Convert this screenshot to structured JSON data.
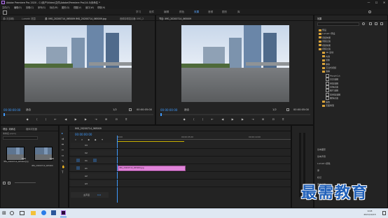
{
  "window": {
    "title": "Adobe Premiere Pro 2020 - C:\\用户\\Video\\文件\\Adobe\\Premiere Pro\\14.0\\未命名 *",
    "minimize": "—",
    "maximize": "☐",
    "close": "✕"
  },
  "menubar": [
    "文件(F)",
    "编辑(E)",
    "剪辑(C)",
    "序列(S)",
    "标记(M)",
    "图形(G)",
    "视图(V)",
    "窗口(W)",
    "帮助(H)"
  ],
  "workspaces": {
    "items": [
      "学习",
      "组件",
      "编辑",
      "颜色",
      "效果",
      "音频",
      "图形",
      "库"
    ],
    "active_index": 4
  },
  "source_monitor": {
    "tabs": [
      "源:(无剪辑)",
      "Lumetri 范围",
      "源: IMG_20200714_065009  IMG_20200714_065009.jpg",
      "音频剪辑混合器: IMG_2"
    ],
    "timecode_left": "00:00:00:00",
    "fit": "适合",
    "fraction": "1/2",
    "timecode_right": "00:00:05:00"
  },
  "program_monitor": {
    "tab": "节目: IMG_20200714_065009",
    "timecode_left": "00:00:00:00",
    "fit": "适合",
    "fraction": "1/2",
    "timecode_right": "00:00:05:00"
  },
  "effects_panel": {
    "title": "效果",
    "items": [
      {
        "label": "预设",
        "type": "folder",
        "indent": 0
      },
      {
        "label": "Lumetri 预设",
        "type": "folder",
        "indent": 0
      },
      {
        "label": "音频效果",
        "type": "folder",
        "indent": 0
      },
      {
        "label": "音频过渡",
        "type": "folder",
        "indent": 0
      },
      {
        "label": "视频效果",
        "type": "folder",
        "indent": 0
      },
      {
        "label": "视频过渡",
        "type": "folder",
        "indent": 0
      },
      {
        "label": "3D 运动",
        "type": "folder",
        "indent": 1
      },
      {
        "label": "内滑",
        "type": "folder",
        "indent": 1
      },
      {
        "label": "划像",
        "type": "folder",
        "indent": 1
      },
      {
        "label": "擦除",
        "type": "folder",
        "indent": 1
      },
      {
        "label": "沉浸式视频",
        "type": "folder",
        "indent": 1
      },
      {
        "label": "溶解",
        "type": "folder",
        "indent": 1
      },
      {
        "label": "MorphCut",
        "type": "effect",
        "indent": 2
      },
      {
        "label": "交叉溶解",
        "type": "effect",
        "indent": 2
      },
      {
        "label": "叠加溶解",
        "type": "effect",
        "indent": 2
      },
      {
        "label": "白场过渡",
        "type": "effect",
        "indent": 2
      },
      {
        "label": "胶片溶解",
        "type": "effect",
        "indent": 2
      },
      {
        "label": "非叠加溶解",
        "type": "effect",
        "indent": 2
      },
      {
        "label": "黑场过渡",
        "type": "effect",
        "indent": 2
      },
      {
        "label": "缩放",
        "type": "folder",
        "indent": 1
      },
      {
        "label": "页面剥落",
        "type": "folder",
        "indent": 1
      }
    ],
    "lower": [
      "基本图形",
      "基本声音",
      "Lumetri 颜色",
      "库",
      "标记",
      "历史记录",
      "信息"
    ]
  },
  "project_panel": {
    "tabs": [
      "项目: 未命名",
      "媒体浏览器"
    ],
    "path": "未命名.prproj",
    "items": [
      {
        "name": "IMG_20200714_065009.jpg",
        "duration": "5:00"
      },
      {
        "name": "IMG_20200714_065009",
        "duration": "5:00"
      }
    ]
  },
  "timeline": {
    "tab": "IMG_20200714_065009",
    "timecode": "00:00:00:00",
    "ruler": [
      "00:00",
      "00:00:05:00",
      "00:00:10:00"
    ],
    "tracks": [
      {
        "name": "V3"
      },
      {
        "name": "V2"
      },
      {
        "name": "V1"
      },
      {
        "name": "A1"
      },
      {
        "name": "A2"
      },
      {
        "name": "A3"
      }
    ],
    "master": "主声道",
    "master_value": "0.0",
    "clip_label": "IMG_20200714_065009.jpg"
  },
  "taskbar": {
    "time": "9:08",
    "date": "2021/10/15"
  },
  "watermark": "最需教育",
  "colors": {
    "accent": "#3f9bff",
    "clip": "#e184d9",
    "workspace_active": "#5aa7ff"
  }
}
